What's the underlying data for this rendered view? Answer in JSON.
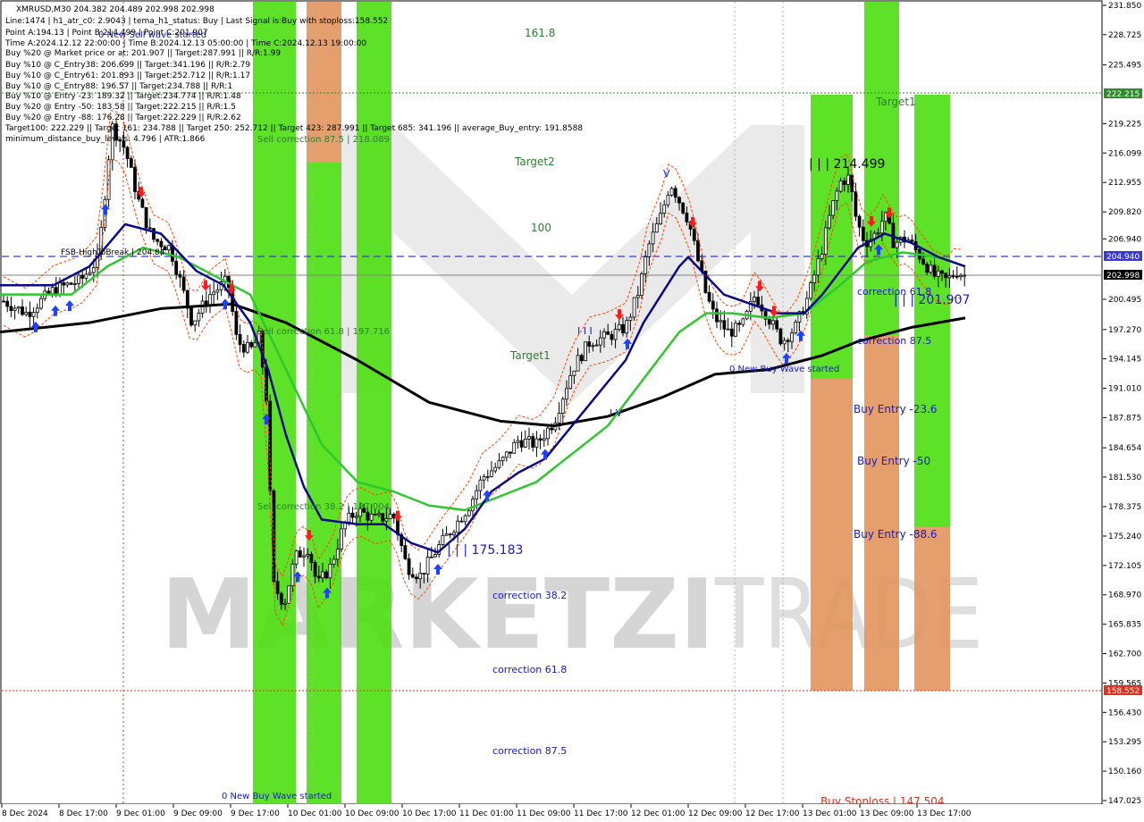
{
  "header": {
    "symbol_line": "XMRUSD,M30  204.382 204.489 202.998 202.998",
    "lines": [
      "Line:1474 | h1_atr_c0: 2.9043 | tema_h1_status: Buy | Last Signal is:Buy with stoploss:158.552",
      "Point A:194.13 | Point B:214.499 | Point C:201.907",
      "Time A:2024.12.12 22:00:00 | Time B:2024.12.13 05:00:00 | Time C:2024.12.13 19:00:00",
      "Buy %20 @ Market price or at: 201.907 || Target:287.991 || R/R:1.99",
      "Buy %10 @ C_Entry38: 206.699 || Target:341.196 || R/R:2.79",
      "Buy %10 @ C_Entry61: 201.893 || Target:252.712 || R/R:1.17",
      "Buy %10 @ C_Entry88: 196.57 || Target:234.788 || R/R:1",
      "Buy %10 @ Entry -23: 189.32 || Target:234.774 || R/R:1.48",
      "Buy %20 @ Entry -50: 183.58 || Target:222.215 || R/R:1.5",
      "Buy %20 @ Entry -88: 176.28 || Target:222.229 || R/R:2.62",
      "Target100: 222.229 || Target 161: 234.788 || Target 250: 252.712 || Target 423: 287.991 || Target 685: 341.196 || average_Buy_entry: 191.8588",
      "minimum_distance_buy_levels: 4.796 | ATR:1.866"
    ]
  },
  "watermark": {
    "part1": "MARKETZI",
    "part2": "TRADE"
  },
  "colors": {
    "ma_fast": "#0a0a8a",
    "ma_mid": "#2ec82e",
    "ma_slow": "#000000",
    "green_zone": "#4ddf10",
    "orange_zone": "#e3955e",
    "buy_arrow": "#1e40ff",
    "sell_arrow": "#ff1a1a",
    "price_line": "#3a3ad8",
    "stop_line": "#e0301e",
    "target_line": "#2e8b2e"
  },
  "price_labels": {
    "target_line": "222.215",
    "price_line": "204.940",
    "current": "202.998",
    "stop": "158.552"
  },
  "annotations": [
    {
      "id": "fib-1618",
      "text": "161.8",
      "color": "#2e7d32"
    },
    {
      "id": "target2",
      "text": "Target2",
      "color": "#2e7d32"
    },
    {
      "id": "fib-100",
      "text": "100",
      "color": "#2e7d32"
    },
    {
      "id": "target1",
      "text": "Target1",
      "color": "#2e7d32"
    },
    {
      "id": "target-right",
      "text": "Target1",
      "color": "#2e7d32"
    },
    {
      "id": "fsb",
      "text": "FSB-HighToBreak | 204.84",
      "color": "#000000"
    },
    {
      "id": "sell-corr-875",
      "text": "Sell correction 87.5 | 218.089",
      "color": "#2e7d32"
    },
    {
      "id": "sell-corr-618",
      "text": "Sell correction 61.8 | 197.716",
      "color": "#2e7d32"
    },
    {
      "id": "sell-corr-382",
      "text": "Sell correction 38.2 | 187.004",
      "color": "#2e7d32"
    },
    {
      "id": "new-sell-wave",
      "text": "0 New Sell wave started",
      "color": "#1a1acc"
    },
    {
      "id": "new-buy-wave-bottom",
      "text": "0 New Buy Wave started",
      "color": "#1a1acc"
    },
    {
      "id": "new-buy-wave-right",
      "text": "0 New Buy Wave started",
      "color": "#1a1acc"
    },
    {
      "id": "point-a-left",
      "text": "| | | 175.183",
      "color": "#1a1acc"
    },
    {
      "id": "point-b",
      "text": "| | | 214.499",
      "color": "#000000"
    },
    {
      "id": "point-c",
      "text": "| | | 201.907",
      "color": "#1a1acc"
    },
    {
      "id": "corr-382",
      "text": "correction 38.2",
      "color": "#1a1acc"
    },
    {
      "id": "corr-618",
      "text": "correction 61.8",
      "color": "#1a1acc"
    },
    {
      "id": "corr-875",
      "text": "correction 87.5",
      "color": "#1a1acc"
    },
    {
      "id": "corr-618-right",
      "text": "correction 61.8",
      "color": "#1a1acc"
    },
    {
      "id": "corr-875-right",
      "text": "correction 87.5",
      "color": "#1a1acc"
    },
    {
      "id": "buy-entry-236",
      "text": "Buy Entry -23.6",
      "color": "#1a1acc"
    },
    {
      "id": "buy-entry-50",
      "text": "Buy Entry -50",
      "color": "#1a1acc"
    },
    {
      "id": "buy-entry-886",
      "text": "Buy Entry -88.6",
      "color": "#1a1acc"
    },
    {
      "id": "buy-stoploss",
      "text": "Buy Stoploss | 147.504",
      "color": "#e0301e"
    },
    {
      "id": "wave-iv",
      "text": "I V",
      "color": "#1a1acc"
    },
    {
      "id": "wave-v",
      "text": "V",
      "color": "#1a1acc"
    },
    {
      "id": "wave-iii",
      "text": "I I I",
      "color": "#1a1acc"
    }
  ],
  "chart_data": {
    "type": "candlestick",
    "symbol": "XMRUSD",
    "timeframe": "M30",
    "ylim": [
      147.025,
      231.85
    ],
    "y_ticks": [
      "231.850",
      "228.725",
      "225.495",
      "222.215",
      "219.225",
      "216.099",
      "212.955",
      "209.820",
      "206.940",
      "204.940",
      "202.998",
      "200.495",
      "197.270",
      "194.145",
      "191.010",
      "187.875",
      "184.654",
      "181.530",
      "178.375",
      "175.240",
      "172.105",
      "168.970",
      "165.835",
      "162.700",
      "159.565",
      "158.552",
      "156.430",
      "153.295",
      "150.160",
      "147.025"
    ],
    "x_labels": [
      "8 Dec 2024",
      "8 Dec 17:00",
      "9 Dec 01:00",
      "9 Dec 09:00",
      "9 Dec 17:00",
      "10 Dec 01:00",
      "10 Dec 09:00",
      "10 Dec 17:00",
      "11 Dec 01:00",
      "11 Dec 09:00",
      "11 Dec 17:00",
      "12 Dec 01:00",
      "12 Dec 09:00",
      "12 Dec 17:00",
      "13 Dec 01:00",
      "13 Dec 09:00",
      "13 Dec 17:00"
    ],
    "last_ohlc": {
      "open": 204.382,
      "high": 204.489,
      "low": 202.998,
      "close": 202.998
    },
    "levels": {
      "target_line": 222.215,
      "price_line": 204.94,
      "current": 202.998,
      "stop": 158.552
    },
    "close_path": [
      [
        0,
        200.5
      ],
      [
        30,
        199.0
      ],
      [
        60,
        201.5
      ],
      [
        90,
        202.5
      ],
      [
        110,
        204.8
      ],
      [
        125,
        219.0
      ],
      [
        140,
        216.5
      ],
      [
        155,
        211.0
      ],
      [
        170,
        207.0
      ],
      [
        190,
        206.0
      ],
      [
        200,
        203.0
      ],
      [
        215,
        198.0
      ],
      [
        235,
        201.0
      ],
      [
        255,
        202.5
      ],
      [
        265,
        196.0
      ],
      [
        280,
        195.0
      ],
      [
        290,
        196.5
      ],
      [
        298,
        190.0
      ],
      [
        306,
        170.0
      ],
      [
        318,
        168.0
      ],
      [
        330,
        173.0
      ],
      [
        345,
        174.0
      ],
      [
        355,
        170.0
      ],
      [
        370,
        172.0
      ],
      [
        385,
        176.5
      ],
      [
        400,
        178.0
      ],
      [
        420,
        177.0
      ],
      [
        440,
        177.5
      ],
      [
        455,
        172.0
      ],
      [
        470,
        171.0
      ],
      [
        490,
        174.0
      ],
      [
        510,
        176.5
      ],
      [
        525,
        178.5
      ],
      [
        540,
        181.5
      ],
      [
        560,
        183.0
      ],
      [
        580,
        185.5
      ],
      [
        600,
        185.0
      ],
      [
        620,
        187.5
      ],
      [
        640,
        193.0
      ],
      [
        660,
        196.0
      ],
      [
        680,
        196.5
      ],
      [
        700,
        197.5
      ],
      [
        715,
        201.5
      ],
      [
        725,
        206.0
      ],
      [
        740,
        209.5
      ],
      [
        750,
        213.0
      ],
      [
        760,
        211.0
      ],
      [
        770,
        209.0
      ],
      [
        780,
        205.0
      ],
      [
        790,
        201.0
      ],
      [
        800,
        198.5
      ],
      [
        815,
        197.0
      ],
      [
        830,
        197.5
      ],
      [
        845,
        201.0
      ],
      [
        860,
        198.5
      ],
      [
        875,
        196.0
      ],
      [
        890,
        197.5
      ],
      [
        905,
        201.0
      ],
      [
        920,
        206.0
      ],
      [
        930,
        210.0
      ],
      [
        940,
        213.0
      ],
      [
        950,
        213.5
      ],
      [
        958,
        209.0
      ],
      [
        968,
        206.5
      ],
      [
        980,
        207.5
      ],
      [
        990,
        209.5
      ],
      [
        1000,
        206.5
      ],
      [
        1015,
        207.0
      ],
      [
        1030,
        205.0
      ],
      [
        1045,
        203.0
      ],
      [
        1060,
        202.5
      ],
      [
        1070,
        203.5
      ],
      [
        1080,
        203.0
      ]
    ],
    "ma_fast": [
      [
        0,
        202.0
      ],
      [
        60,
        202.0
      ],
      [
        100,
        204.0
      ],
      [
        140,
        208.5
      ],
      [
        180,
        207.5
      ],
      [
        220,
        203.5
      ],
      [
        250,
        202.0
      ],
      [
        280,
        198.0
      ],
      [
        300,
        193.0
      ],
      [
        320,
        186.0
      ],
      [
        340,
        180.5
      ],
      [
        360,
        177.0
      ],
      [
        400,
        176.5
      ],
      [
        430,
        176.5
      ],
      [
        460,
        174.5
      ],
      [
        490,
        173.5
      ],
      [
        520,
        176.0
      ],
      [
        550,
        180.0
      ],
      [
        580,
        182.0
      ],
      [
        610,
        183.5
      ],
      [
        640,
        187.0
      ],
      [
        670,
        190.5
      ],
      [
        700,
        194.0
      ],
      [
        720,
        198.0
      ],
      [
        740,
        201.0
      ],
      [
        760,
        204.0
      ],
      [
        770,
        205.0
      ],
      [
        790,
        203.0
      ],
      [
        810,
        201.0
      ],
      [
        840,
        200.0
      ],
      [
        870,
        199.0
      ],
      [
        900,
        199.0
      ],
      [
        920,
        201.0
      ],
      [
        940,
        203.5
      ],
      [
        960,
        206.0
      ],
      [
        990,
        207.5
      ],
      [
        1020,
        206.5
      ],
      [
        1050,
        205.0
      ],
      [
        1080,
        204.0
      ]
    ],
    "ma_mid": [
      [
        0,
        201.0
      ],
      [
        80,
        201.0
      ],
      [
        120,
        204.0
      ],
      [
        160,
        206.0
      ],
      [
        200,
        205.0
      ],
      [
        240,
        203.0
      ],
      [
        280,
        201.0
      ],
      [
        320,
        193.0
      ],
      [
        360,
        185.0
      ],
      [
        400,
        181.0
      ],
      [
        440,
        180.0
      ],
      [
        480,
        178.5
      ],
      [
        520,
        178.0
      ],
      [
        560,
        179.5
      ],
      [
        600,
        181.0
      ],
      [
        640,
        184.0
      ],
      [
        680,
        187.0
      ],
      [
        720,
        192.0
      ],
      [
        760,
        197.0
      ],
      [
        790,
        199.0
      ],
      [
        820,
        199.0
      ],
      [
        860,
        198.5
      ],
      [
        900,
        199.0
      ],
      [
        940,
        202.0
      ],
      [
        970,
        204.5
      ],
      [
        1010,
        205.5
      ],
      [
        1050,
        205.0
      ],
      [
        1080,
        204.0
      ]
    ],
    "ma_slow": [
      [
        0,
        197.0
      ],
      [
        100,
        198.0
      ],
      [
        180,
        199.5
      ],
      [
        260,
        200.0
      ],
      [
        320,
        198.0
      ],
      [
        400,
        194.0
      ],
      [
        480,
        189.5
      ],
      [
        560,
        187.5
      ],
      [
        620,
        187.0
      ],
      [
        680,
        188.0
      ],
      [
        740,
        190.0
      ],
      [
        800,
        192.5
      ],
      [
        860,
        193.0
      ],
      [
        920,
        194.5
      ],
      [
        960,
        196.0
      ],
      [
        1020,
        197.5
      ],
      [
        1080,
        198.5
      ]
    ]
  }
}
